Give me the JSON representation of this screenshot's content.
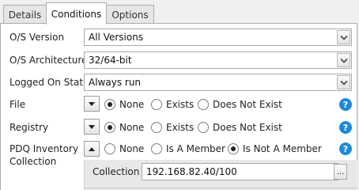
{
  "tabs": [
    {
      "label": "Details"
    },
    {
      "label": "Conditions"
    },
    {
      "label": "Options"
    }
  ],
  "fields": {
    "os_version": {
      "label": "O/S Version",
      "value": "All Versions"
    },
    "os_architecture": {
      "label": "O/S Architecture",
      "value": "32/64-bit"
    },
    "logged_on_state": {
      "label": "Logged On State",
      "value": "Always run"
    }
  },
  "conditions": {
    "file": {
      "label": "File",
      "options": [
        "None",
        "Exists",
        "Does Not Exist"
      ],
      "selected": "None"
    },
    "registry": {
      "label": "Registry",
      "options": [
        "None",
        "Exists",
        "Does Not Exist"
      ],
      "selected": "None"
    },
    "pdq": {
      "label_line1": "PDQ Inventory",
      "label_line2": "Collection",
      "options": [
        "None",
        "Is A Member",
        "Is Not A Member"
      ],
      "selected": "Is Not A Member"
    }
  },
  "collection": {
    "label": "Collection",
    "value": "192.168.82.40/100",
    "browse_label": "..."
  },
  "help_glyph": "?",
  "icons": {
    "dropdown": "chevron-down-icon",
    "expand": "triangle-down-icon",
    "collapse": "triangle-up-icon",
    "help": "help-icon"
  },
  "colors": {
    "help": "#1c8ad8",
    "sub_panel": "#e8e8e8",
    "tab_active": "#ffffff",
    "tab_inactive": "#e6e6e6"
  }
}
